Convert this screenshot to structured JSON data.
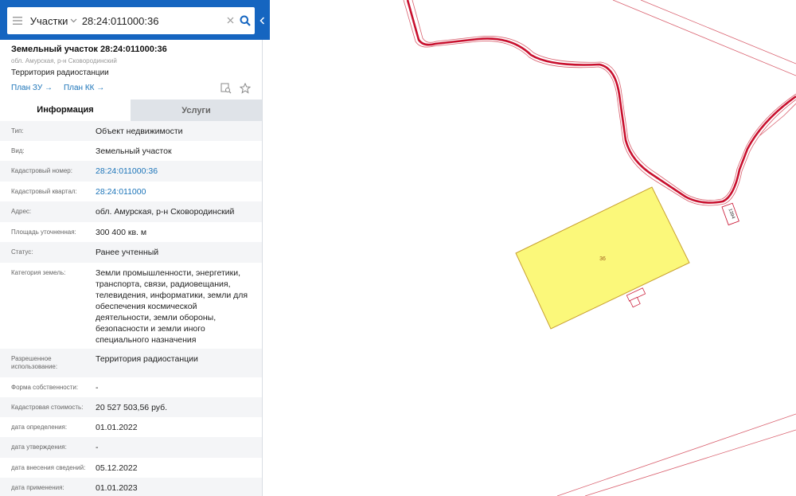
{
  "search": {
    "category": "Участки",
    "query": "28:24:011000:36"
  },
  "parcel": {
    "title": "Земельный участок 28:24:011000:36",
    "subaddress": "обл. Амурская, р-н Сковородинский",
    "description": "Территория радиостанции",
    "link_plan_zu": "План ЗУ →",
    "link_plan_kk": "План КК →"
  },
  "tabs": {
    "info": "Информация",
    "services": "Услуги"
  },
  "rows": [
    {
      "label": "Тип:",
      "value": "Объект недвижимости"
    },
    {
      "label": "Вид:",
      "value": "Земельный участок"
    },
    {
      "label": "Кадастровый номер:",
      "value": "28:24:011000:36"
    },
    {
      "label": "Кадастровый квартал:",
      "value": "28:24:011000"
    },
    {
      "label": "Адрес:",
      "value": "обл. Амурская, р-н Сковородинский"
    },
    {
      "label": "Площадь уточненная:",
      "value": "300 400 кв. м"
    },
    {
      "label": "Статус:",
      "value": "Ранее учтенный"
    },
    {
      "label": "Категория земель:",
      "value": "Земли промышленности, энергетики, транспорта, связи, радиовещания, телевидения, информатики, земли для обеспечения космической деятельности, земли обороны, безопасности и земли иного специального назначения"
    },
    {
      "label": "Разрешенное использование:",
      "value": "Территория радиостанции"
    },
    {
      "label": "Форма собственности:",
      "value": "-"
    },
    {
      "label": "Кадастровая стоимость:",
      "value": "20 527 503,56 руб."
    },
    {
      "label": "дата определения:",
      "value": "01.01.2022"
    },
    {
      "label": "дата утверждения:",
      "value": "-"
    },
    {
      "label": "дата внесения сведений:",
      "value": "05.12.2022"
    },
    {
      "label": "дата применения:",
      "value": "01.01.2023"
    }
  ],
  "map": {
    "parcel_label": "36",
    "road_label": "1394",
    "road_color": "#c8102e",
    "parcel_fill": "#fbf87a"
  },
  "colors": {
    "accent": "#1565c0",
    "link": "#1a73b8"
  },
  "icons": {
    "menu": "hamburger-icon",
    "search": "search-icon",
    "clear": "close-icon",
    "collapse": "chevron-left-icon",
    "zoom_to": "zoom-to-object-icon",
    "favorite": "star-icon"
  }
}
